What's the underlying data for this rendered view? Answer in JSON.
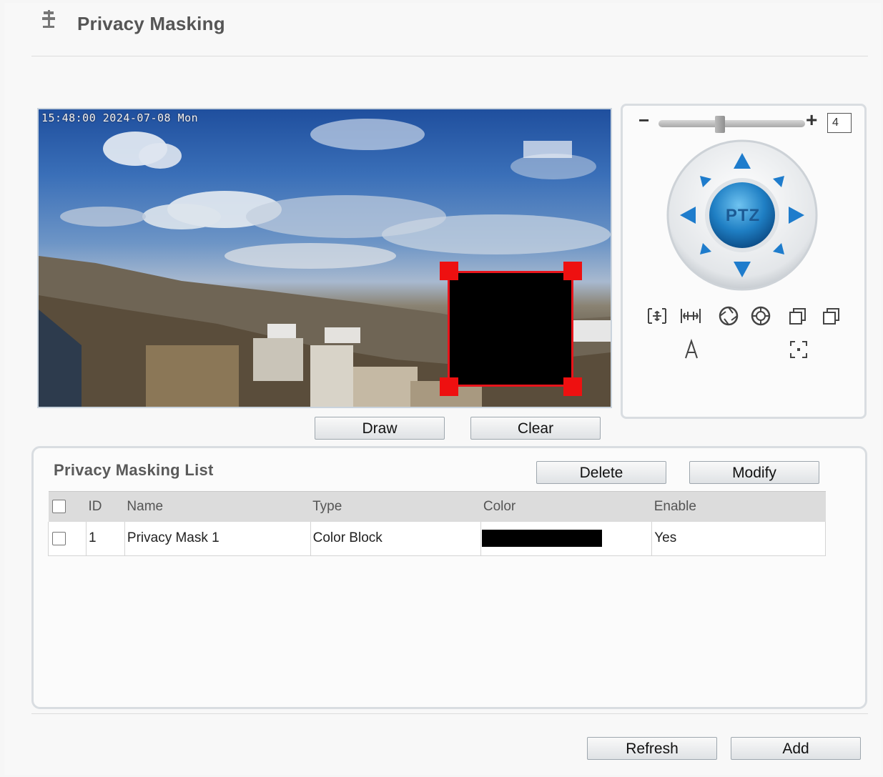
{
  "header": {
    "title": "Privacy Masking",
    "icon": "pin-icon"
  },
  "video": {
    "osd_time": "15:48:00 2024-07-08 Mon"
  },
  "actions": {
    "draw_label": "Draw",
    "clear_label": "Clear"
  },
  "ptz": {
    "zoom_value": "4",
    "zoom_level_fraction": 0.42,
    "center_label": "PTZ",
    "tools": [
      "zoom-in-icon",
      "zoom-out-icon",
      "focus-near-icon",
      "focus-far-icon",
      "iris-open-icon",
      "iris-close-icon",
      "auto-focus-icon",
      "one-key-focus-icon"
    ]
  },
  "list": {
    "title": "Privacy Masking List",
    "delete_label": "Delete",
    "modify_label": "Modify",
    "columns": {
      "id": "ID",
      "name": "Name",
      "type": "Type",
      "color": "Color",
      "enable": "Enable"
    },
    "rows": [
      {
        "id": "1",
        "name": "Privacy Mask 1",
        "type": "Color Block",
        "color": "#000000",
        "enable": "Yes"
      }
    ]
  },
  "footer": {
    "refresh_label": "Refresh",
    "add_label": "Add"
  }
}
